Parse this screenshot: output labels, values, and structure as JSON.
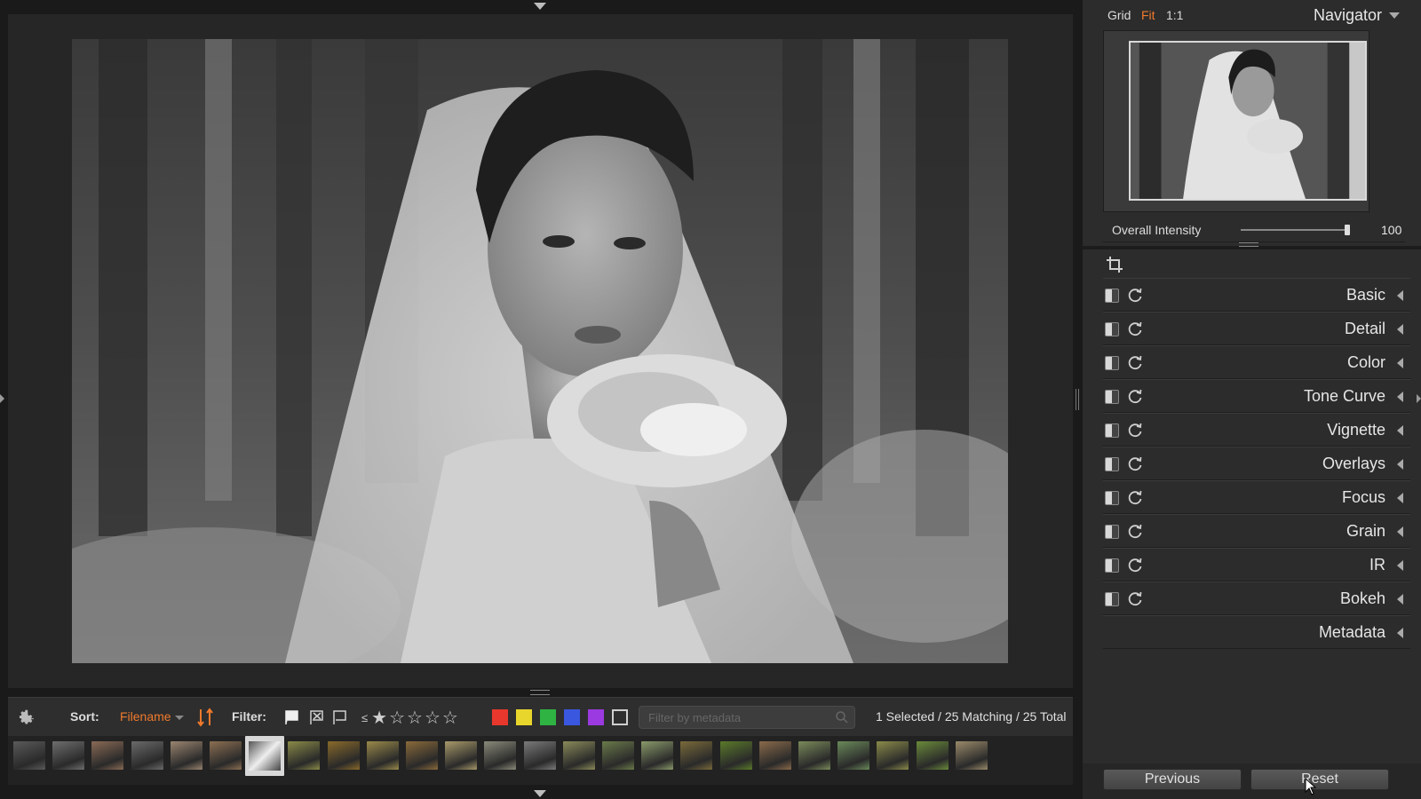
{
  "viewer": {
    "photo_alt": "black and white bride holding bouquet"
  },
  "toolbar": {
    "sort_label": "Sort:",
    "sort_value": "Filename",
    "filter_label": "Filter:",
    "rating_prefix": "≤",
    "color_filters": [
      "#e8372c",
      "#e8d62c",
      "#2fb342",
      "#3a57e0",
      "#9b3ae0"
    ],
    "metadata_placeholder": "Filter by metadata",
    "counts": "1 Selected / 25 Matching / 25 Total"
  },
  "filmstrip": {
    "selected_index": 6,
    "thumbs": [
      "#5a5a5a",
      "#6e6e6e",
      "#8a6a55",
      "#6a6a6a",
      "#9a8570",
      "#8c6f52",
      "#dcdcdc",
      "#8a8a48",
      "#8a6a2a",
      "#9a8a4a",
      "#8a6a3a",
      "#a89a6a",
      "#8a8a7a",
      "#7a7a7a",
      "#8a8a5a",
      "#6a7a4a",
      "#8a9a6a",
      "#7a6a3a",
      "#5a7a2a",
      "#8a6a4a",
      "#7a8a5a",
      "#6a8a5a",
      "#8a8a4a",
      "#6a8a3a",
      "#9a8a6a"
    ]
  },
  "navigator": {
    "tabs": [
      "Grid",
      "Fit",
      "1:1"
    ],
    "active_tab": "Fit",
    "title": "Navigator"
  },
  "intensity": {
    "label": "Overall Intensity",
    "value": "100",
    "fraction": 1.0
  },
  "adjustments": [
    {
      "name": "Basic"
    },
    {
      "name": "Detail"
    },
    {
      "name": "Color"
    },
    {
      "name": "Tone Curve"
    },
    {
      "name": "Vignette"
    },
    {
      "name": "Overlays"
    },
    {
      "name": "Focus"
    },
    {
      "name": "Grain"
    },
    {
      "name": "IR"
    },
    {
      "name": "Bokeh"
    },
    {
      "name": "Metadata",
      "no_controls": true
    }
  ],
  "buttons": {
    "previous": "Previous",
    "reset": "Reset"
  },
  "colors": {
    "accent": "#f07a2c",
    "panel": "#2c2c2c",
    "background": "#1a1a1a"
  }
}
